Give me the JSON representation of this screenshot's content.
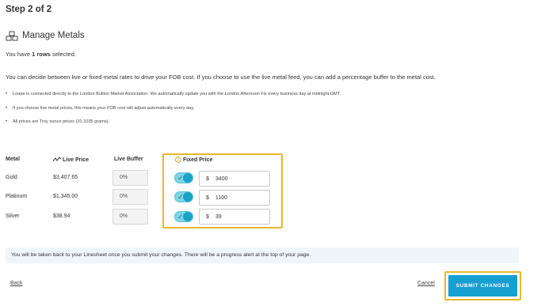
{
  "step_title": "Step 2 of 2",
  "section": {
    "title": "Manage Metals",
    "icon": "gold-bars-icon"
  },
  "selection": {
    "prefix": "You have ",
    "count": "1 rows",
    "suffix": " selected."
  },
  "intro": "You can decide between live or fixed metal rates to drive your FOB cost. If you choose to use the live metal feed, you can add a percentage buffer to the metal cost.",
  "bullets": [
    "Loupe is connected directly to the London Bullion Market Association. We automatically update you with the London Afternoon Fix every business day at midnight GMT.",
    "If you choose live metal prices, this means your FOB cost will adjust automatically every day.",
    "All prices are Troy ounce prices (31.1035 grams)."
  ],
  "table": {
    "headers": {
      "metal": "Metal",
      "live_price": "Live Price",
      "live_buffer": "Live Buffer",
      "fixed_price": "Fixed Price"
    },
    "rows": [
      {
        "metal": "Gold",
        "live_price": "$3,407.65",
        "buffer": "0%",
        "fixed_enabled": true,
        "currency": "$",
        "fixed_price": "3400"
      },
      {
        "metal": "Platinum",
        "live_price": "$1,345.00",
        "buffer": "0%",
        "fixed_enabled": true,
        "currency": "$",
        "fixed_price": "1100"
      },
      {
        "metal": "Silver",
        "live_price": "$38.94",
        "buffer": "0%",
        "fixed_enabled": true,
        "currency": "$",
        "fixed_price": "39"
      }
    ]
  },
  "notice": "You will be taken back to your Linesheet once you submit your changes. There will be a progress alert at the top of your page.",
  "actions": {
    "back": "Back",
    "cancel": "Cancel",
    "submit": "SUBMIT CHANGES"
  },
  "colors": {
    "accent": "#169fd1",
    "highlight": "#e8b72a",
    "toggle_on": "#1aa2c7",
    "notice_bg": "#eef6fa"
  }
}
